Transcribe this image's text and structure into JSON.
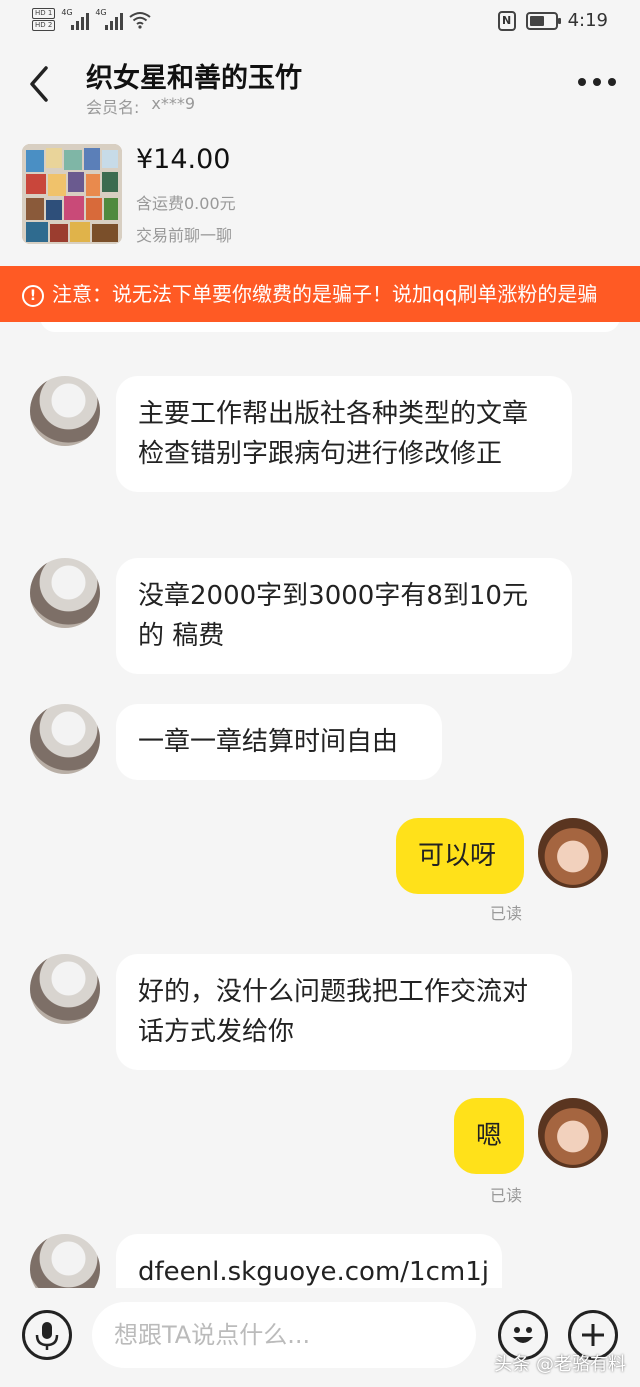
{
  "status_bar": {
    "sim1": "HD 1",
    "sim2": "HD 2",
    "net1": "4G",
    "net2": "4G",
    "nfc": "N",
    "battery_level": 0.6,
    "time": "4:19"
  },
  "header": {
    "title": "织女星和善的玉竹",
    "member_label": "会员名:",
    "member_value": "x***9"
  },
  "product": {
    "price": "¥14.00",
    "shipping": "含运费0.00元",
    "note": "交易前聊一聊"
  },
  "notice": {
    "text": "注意：说无法下单要你缴费的是骗子！说加qq刷单涨粉的是骗"
  },
  "messages": [
    {
      "side": "left",
      "text": "主要工作帮出版社各种类型的文章检查错别字跟病句进行修改修正"
    },
    {
      "side": "left",
      "text": "没章2000字到3000字有8到10元的 稿费"
    },
    {
      "side": "left",
      "text": "一章一章结算时间自由"
    },
    {
      "side": "right",
      "text": "可以呀",
      "status": "已读"
    },
    {
      "side": "left",
      "text": "好的，没什么问题我把工作交流对话方式发给你"
    },
    {
      "side": "right",
      "text": "嗯",
      "status": "已读"
    },
    {
      "side": "left",
      "text": "dfeenl.skguoye.com/1cm1j"
    }
  ],
  "input": {
    "placeholder": "想跟TA说点什么..."
  },
  "watermark": "头条 @老骆有料",
  "colors": {
    "accent_yellow": "#ffe11a",
    "notice_orange": "#ff5a24"
  }
}
